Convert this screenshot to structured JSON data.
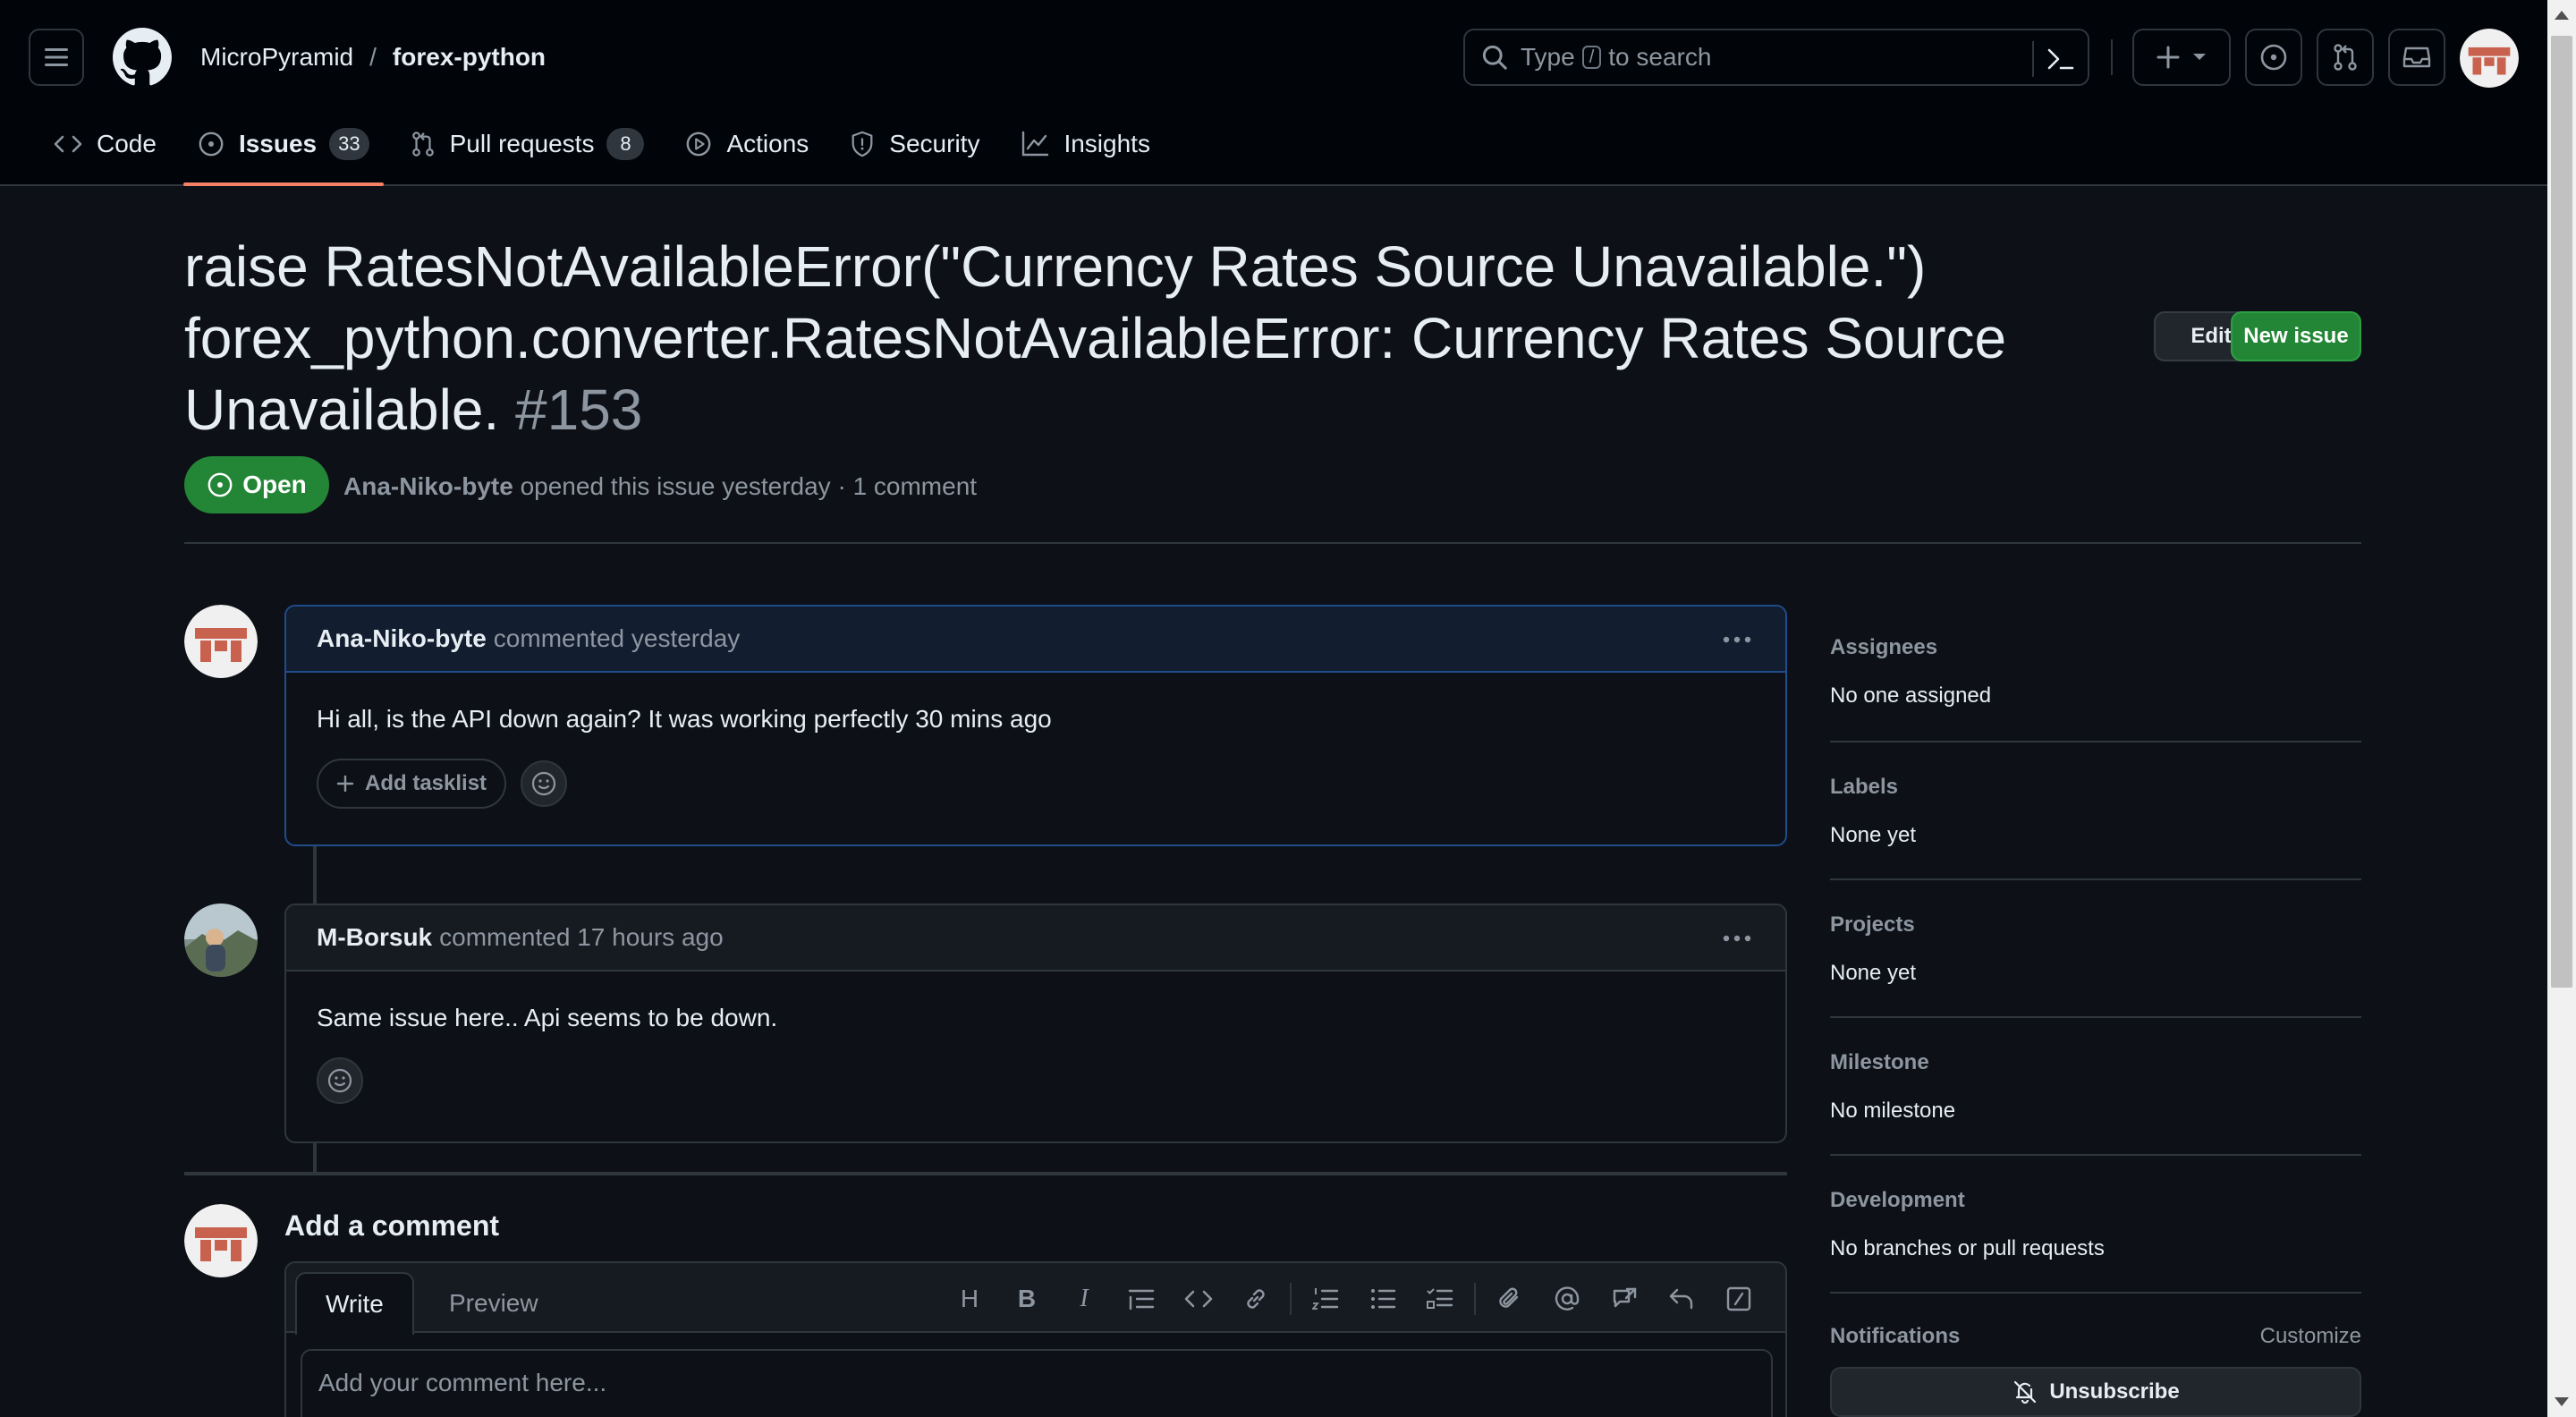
{
  "header": {
    "owner": "MicroPyramid",
    "separator": "/",
    "repo": "forex-python",
    "search": {
      "prefix": "Type",
      "key": "/",
      "suffix": "to search"
    },
    "icons": [
      "menu-icon",
      "github-logo-icon",
      "search-icon",
      "command-palette-icon",
      "plus-icon",
      "issues-icon",
      "pull-requests-icon",
      "inbox-icon",
      "avatar"
    ]
  },
  "tabs": [
    {
      "label": "Code",
      "icon": "code-icon"
    },
    {
      "label": "Issues",
      "icon": "issue-icon",
      "count": "33",
      "active": true
    },
    {
      "label": "Pull requests",
      "icon": "pull-request-icon",
      "count": "8"
    },
    {
      "label": "Actions",
      "icon": "play-icon"
    },
    {
      "label": "Security",
      "icon": "shield-icon"
    },
    {
      "label": "Insights",
      "icon": "graph-icon"
    }
  ],
  "issue": {
    "title": "raise RatesNotAvailableError(\"Currency Rates Source Unavailable.\") forex_python.converter.RatesNotAvailableError: Currency Rates Source Unavailable.",
    "number": "#153",
    "state": "Open",
    "author": "Ana-Niko-byte",
    "meta_text": "opened this issue yesterday · 1 comment",
    "edit_label": "Edit",
    "new_issue_label": "New issue"
  },
  "comments": [
    {
      "author": "Ana-Niko-byte",
      "action": "commented",
      "time": "yesterday",
      "body": "Hi all, is the API down again? It was working perfectly 30 mins ago",
      "tasklist_label": "Add tasklist"
    },
    {
      "author": "M-Borsuk",
      "action": "commented",
      "time": "17 hours ago",
      "body": "Same issue here.. Api seems to be down."
    }
  ],
  "composer": {
    "title": "Add a comment",
    "write_tab": "Write",
    "preview_tab": "Preview",
    "heading_tool": "H",
    "bold_tool": "B",
    "italic_tool": "I",
    "placeholder": "Add your comment here..."
  },
  "sidebar": {
    "assignees": {
      "label": "Assignees",
      "value": "No one assigned"
    },
    "labels": {
      "label": "Labels",
      "value": "None yet"
    },
    "projects": {
      "label": "Projects",
      "value": "None yet"
    },
    "milestone": {
      "label": "Milestone",
      "value": "No milestone"
    },
    "development": {
      "label": "Development",
      "value": "No branches or pull requests"
    },
    "notifications": {
      "label": "Notifications",
      "customize": "Customize",
      "unsubscribe": "Unsubscribe"
    }
  },
  "colors": {
    "accent_green": "#238636",
    "tab_underline": "#f78166",
    "background": "#0d1117"
  }
}
